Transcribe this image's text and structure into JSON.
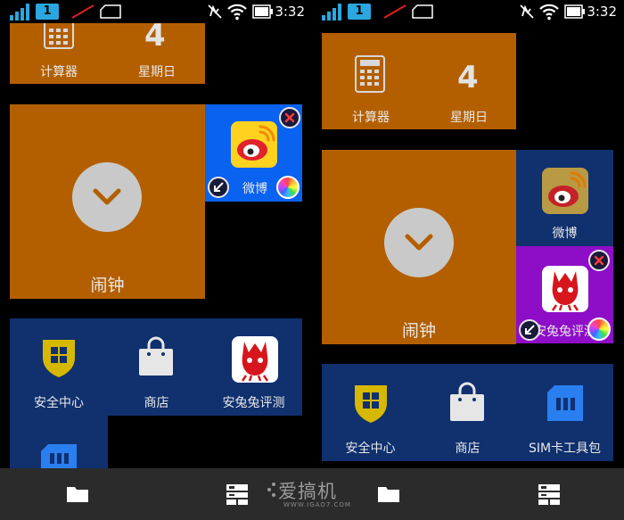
{
  "status": {
    "sim_number": "1",
    "time": "3:32"
  },
  "left": {
    "tiles": {
      "calculator": "计算器",
      "calendar_day": "4",
      "calendar_weekday": "星期日",
      "alarm": "闹钟",
      "weibo": "微博",
      "security": "安全中心",
      "store": "商店",
      "antutu": "安兔兔评测"
    }
  },
  "right": {
    "tiles": {
      "calculator": "计算器",
      "calendar_day": "4",
      "calendar_weekday": "星期日",
      "alarm": "闹钟",
      "weibo": "微博",
      "antutu": "安兔兔评测",
      "security": "安全中心",
      "store": "商店",
      "sim_toolkit": "SIM卡工具包"
    }
  },
  "watermark": {
    "text": "爱搞机",
    "url": "WWW.IGAO7.COM"
  },
  "colors": {
    "orange_tile": "#b35f00",
    "navy_tile": "#10306e",
    "blue_tile": "#0a62f0",
    "purple_tile": "#8e0ec8",
    "accent_cyan": "#2aa7e0"
  }
}
